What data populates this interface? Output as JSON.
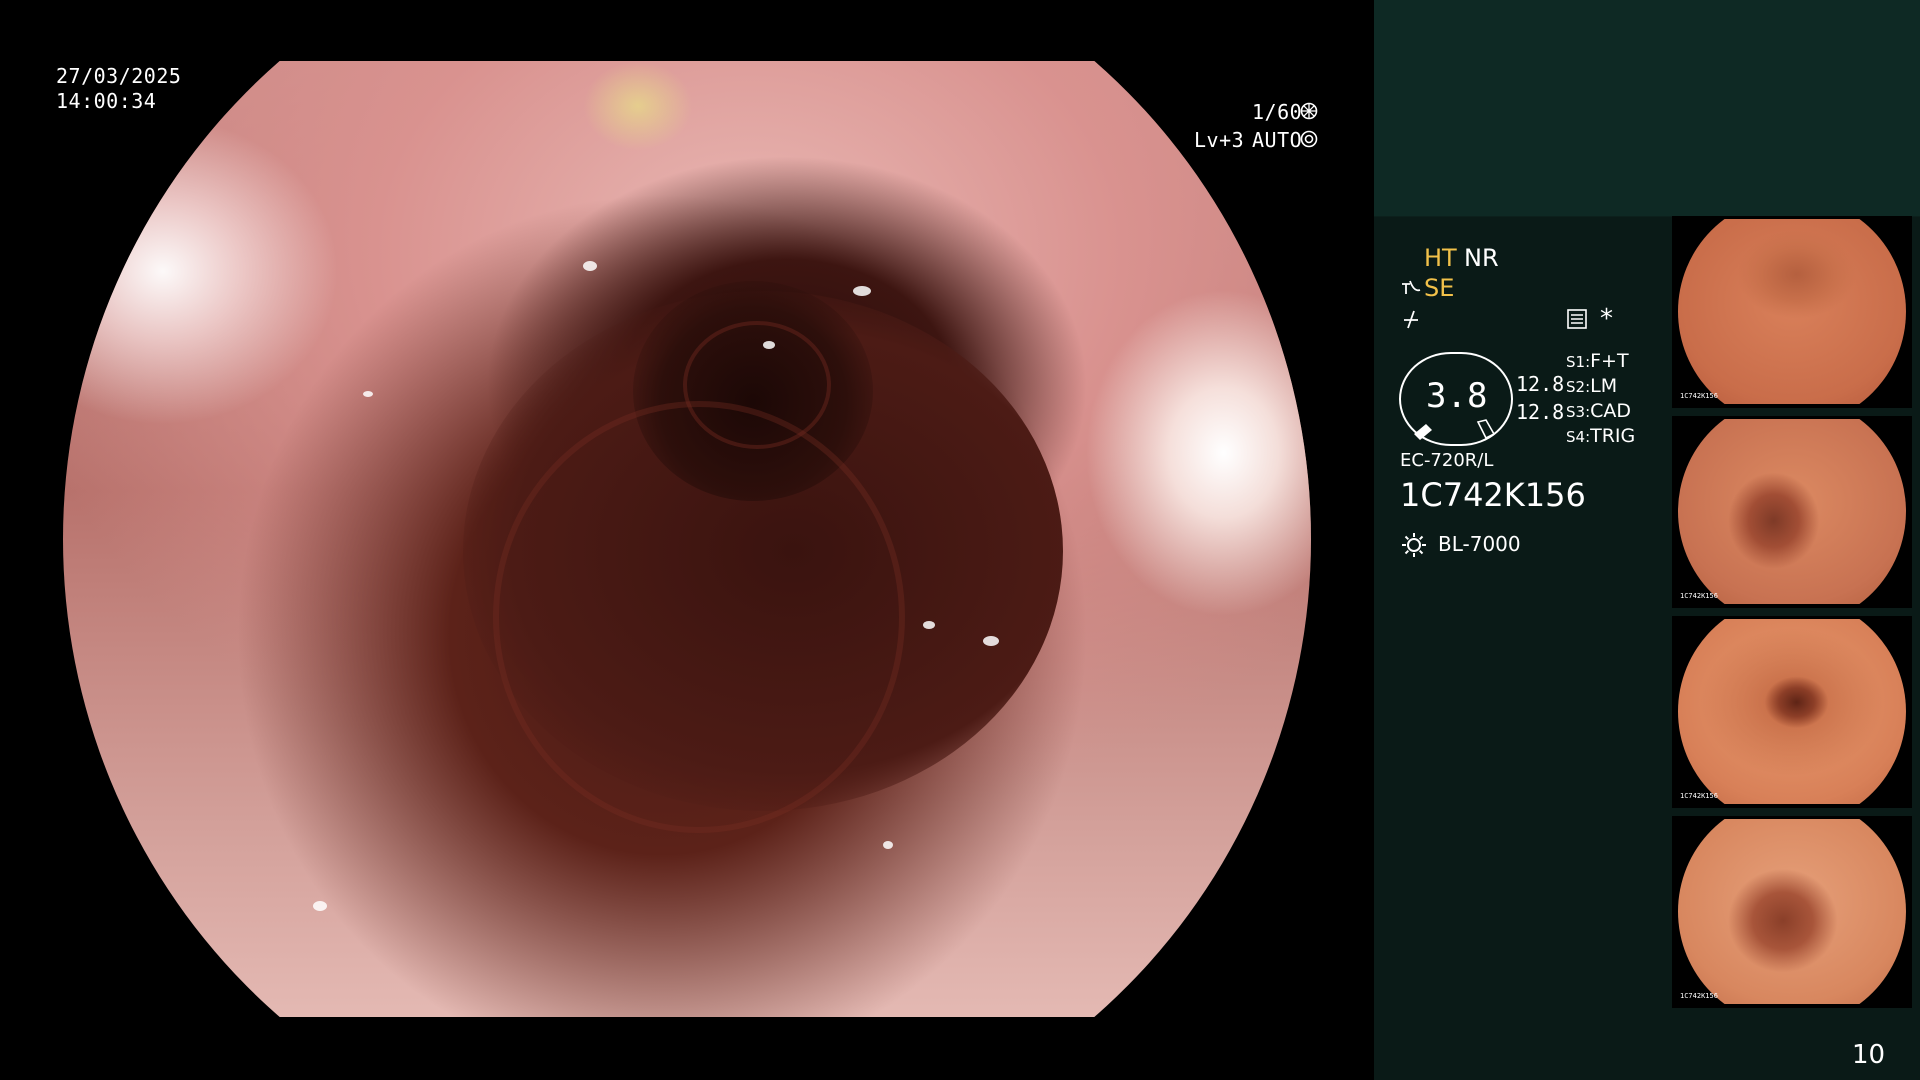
{
  "overlay": {
    "date": "27/03/2025",
    "time": "14:00:34",
    "shutter": "1/60",
    "shutter_icon": "aperture-icon",
    "level": "Lv+3",
    "mode": "AUTO",
    "mode_icon": "iris-icon"
  },
  "panel": {
    "ht": "HT",
    "nr": "NR",
    "se": "SE",
    "asterisk": "*",
    "gauge_value": "3.8",
    "readout_1": "12.8",
    "readout_2": "12.8",
    "switches": [
      {
        "key": "S1:",
        "value": "F+T"
      },
      {
        "key": "S2:",
        "value": "LM"
      },
      {
        "key": "S3:",
        "value": "CAD"
      },
      {
        "key": "S4:",
        "value": "TRIG"
      }
    ],
    "scope_model": "EC-720R/L",
    "serial": "1C742K156",
    "light_source": "BL-7000",
    "frame_count": "10",
    "colors": {
      "accent_yellow": "#f2c14a",
      "panel_bg": "#0a1a17",
      "panel_top": "#0e2924"
    }
  },
  "thumbnails": [
    {
      "caption_serial": "1C742K156"
    },
    {
      "caption_serial": "1C742K156"
    },
    {
      "caption_serial": "1C742K156"
    },
    {
      "caption_serial": "1C742K156"
    }
  ]
}
